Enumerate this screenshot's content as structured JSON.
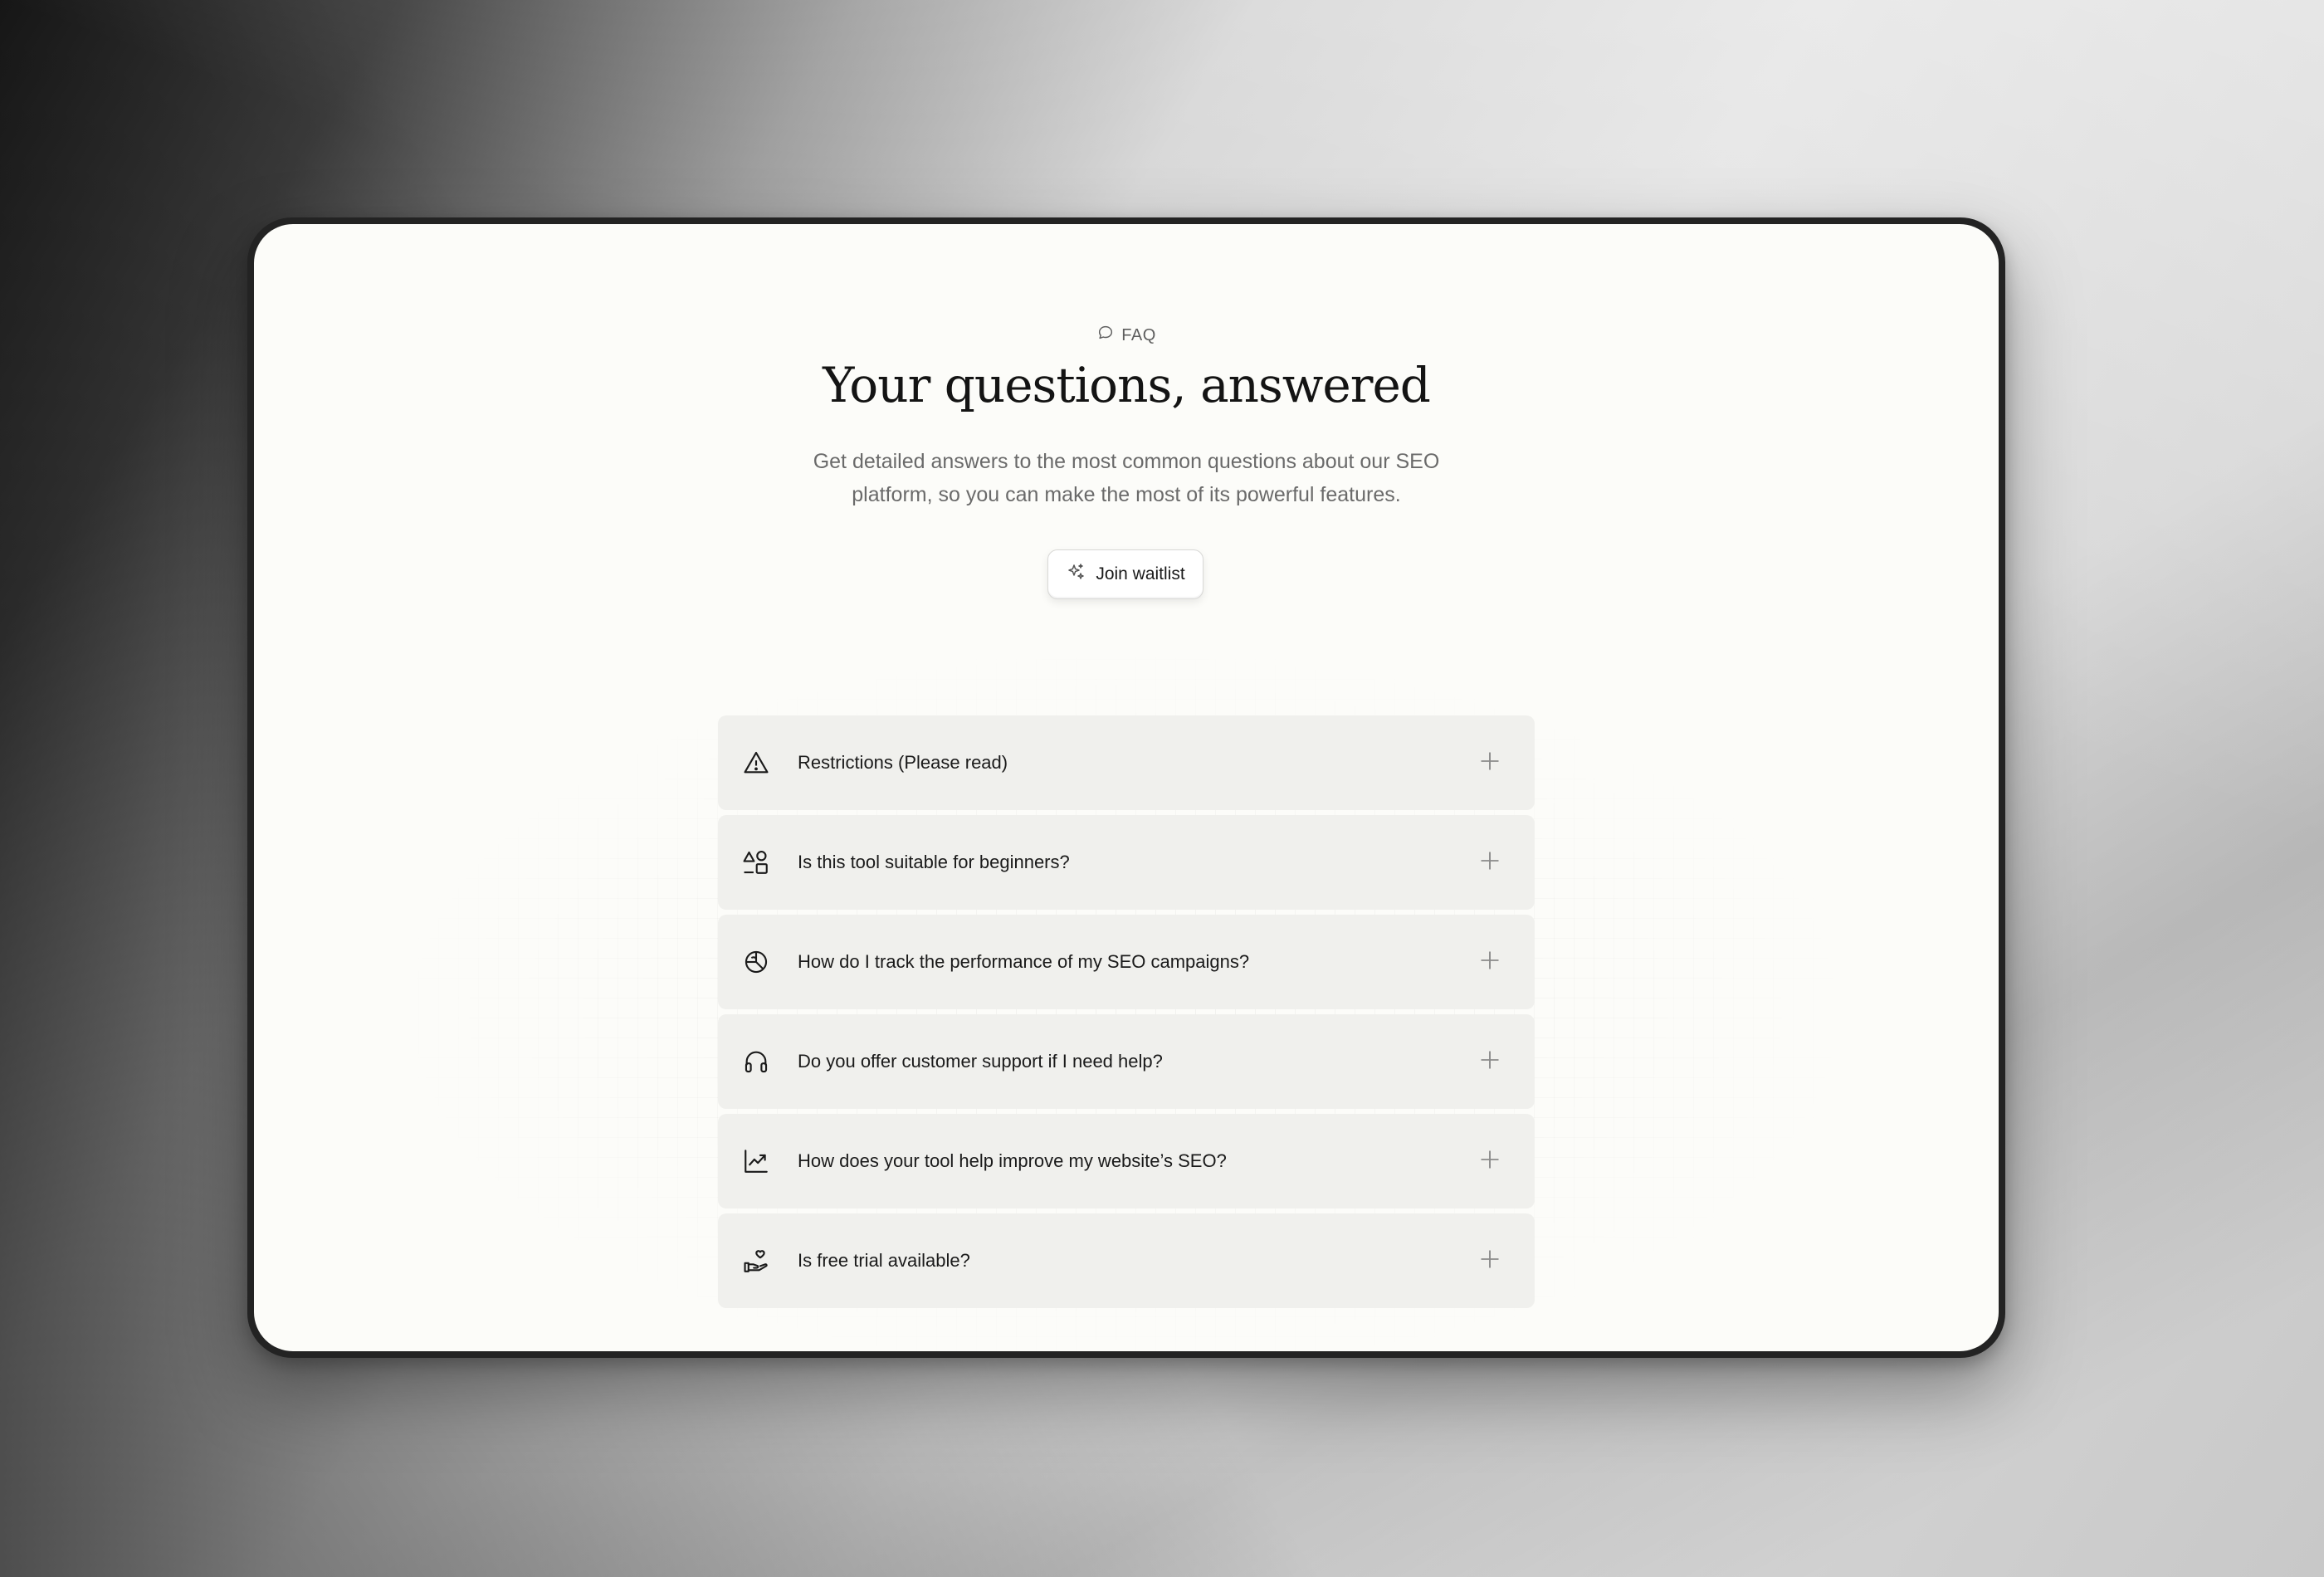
{
  "eyebrow": {
    "label": "FAQ",
    "icon": "chat-bubble-icon"
  },
  "title": "Your questions, answered",
  "subtitle": "Get detailed answers to the most common questions about our SEO platform, so you can make the most of its powerful features.",
  "cta": {
    "label": "Join waitlist",
    "icon": "sparkle-icon"
  },
  "faq": [
    {
      "question": "Restrictions (Please read)",
      "icon": "warning-triangle-icon"
    },
    {
      "question": "Is this tool suitable for beginners?",
      "icon": "shapes-icon"
    },
    {
      "question": "How do I track the performance of my SEO campaigns?",
      "icon": "chart-pie-icon"
    },
    {
      "question": "Do you offer customer support if I need help?",
      "icon": "headphones-icon"
    },
    {
      "question": "How does your tool help improve my website’s SEO?",
      "icon": "trend-up-icon"
    },
    {
      "question": "Is free trial available?",
      "icon": "hand-heart-icon"
    }
  ],
  "colors": {
    "screen": "#fcfcf9",
    "item": "#f0f0ed",
    "text": "#1a1a1a",
    "muted": "#6a6a6a"
  }
}
